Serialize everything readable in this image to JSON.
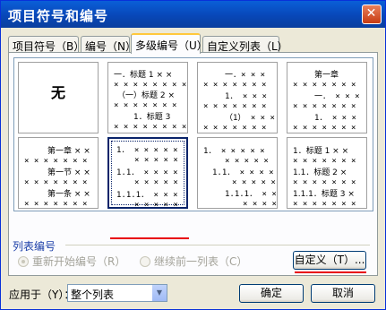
{
  "dialog": {
    "title": "项目符号和编号",
    "close_symbol": "✕"
  },
  "tabs": [
    {
      "label": "项目符号（B）",
      "active": false
    },
    {
      "label": "编号（N）",
      "active": false
    },
    {
      "label": "多级编号（U）",
      "active": true
    },
    {
      "label": "自定义列表（L）",
      "active": false
    }
  ],
  "gallery": {
    "none_label": "无",
    "cells": [
      {
        "lines": [
          "一．标题 1 × ×",
          "× × × × × × × ×",
          "（一）标题 2 ×",
          "× × × × × × ×",
          "1．标题 3",
          "× × × × × × × ×"
        ]
      },
      {
        "lines": [
          "一．× × ×",
          "× × × × × × ×",
          "1． × × ×",
          "× × × × × × ×",
          "（1） × × ×",
          "× × × × × × ×"
        ]
      },
      {
        "lines": [
          "第一章",
          "× × × × × × ×",
          "一． × × ×",
          "× × × × × × ×",
          "1． × × ×",
          "× × × × × × ×"
        ]
      },
      {
        "lines": [
          "第一章 × ×",
          "× × × × × × ×",
          "第一节 × ×",
          "× × × × × × ×",
          "第一条 × ×",
          "× × × × × × ×"
        ]
      },
      {
        "lines": [
          "1． × × × × ×",
          "× × × × ×",
          "1.1． × × × ×",
          "× × × × ×",
          "1.1.1． × × ×",
          "× × × × ×"
        ]
      },
      {
        "lines": [
          "1． × × × × ×",
          "× × × × ×",
          "1.1． × × × ×",
          "× × × × ×",
          "1.1.1． × ×",
          "× × × ×"
        ]
      },
      {
        "lines": [
          "1．标题 1 × ×",
          "× × × × × × ×",
          "1.1．标题 2 ×",
          "× × × × × × ×",
          "1.1.1．标题 3 ×",
          "× × × × × × ×"
        ]
      }
    ]
  },
  "list_numbering": {
    "label": "列表编号",
    "restart_label": "重新开始编号（R）",
    "continue_label": "继续前一列表（C）"
  },
  "buttons": {
    "customize": "自定义（T）...",
    "ok": "确定",
    "cancel": "取消"
  },
  "apply_to": {
    "label": "应用于（Y）：",
    "value": "整个列表"
  },
  "colors": {
    "title_bar": "#0a5fd8",
    "annotation_underline": "#e8000b",
    "selection": "#0a246a"
  }
}
